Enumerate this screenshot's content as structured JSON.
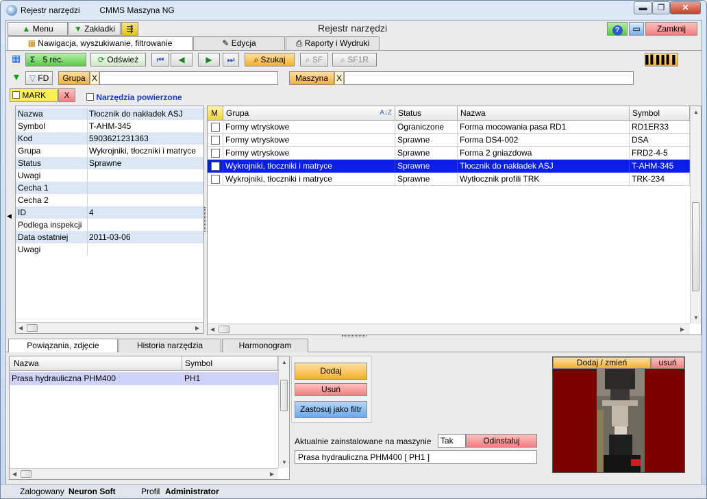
{
  "window": {
    "app_name": "Rejestr narzędzi",
    "product": "CMMS Maszyna NG",
    "minimize": "▬",
    "maximize": "❐",
    "close": "✕"
  },
  "toolbar": {
    "menu": "Menu",
    "bookmarks": "Zakładki",
    "title": "Rejestr narzędzi",
    "close": "Zamknij"
  },
  "main_tabs": [
    {
      "label": "Nawigacja, wyszukiwanie, filtrowanie"
    },
    {
      "label": "Edycja"
    },
    {
      "label": "Raporty i Wydruki"
    }
  ],
  "nav": {
    "records": "5 rec.",
    "refresh": "Odśwież",
    "search": "Szukaj",
    "sf": "SF",
    "sf1r": "SF1R"
  },
  "filters": {
    "fd": "FD",
    "group_label": "Grupa",
    "group_value": "",
    "machine_label": "Maszyna",
    "machine_value": "",
    "clear": "X",
    "mark": "MARK",
    "lent_tools": "Narzędzia powierzone"
  },
  "details": [
    {
      "key": "Nazwa",
      "value": "Tłocznik  do nakładek ASJ"
    },
    {
      "key": "Symbol",
      "value": "T-AHM-345"
    },
    {
      "key": "Kod",
      "value": "5903621231363"
    },
    {
      "key": "Grupa",
      "value": "Wykrojniki, tłoczniki i matryce"
    },
    {
      "key": "Status",
      "value": "Sprawne"
    },
    {
      "key": "Uwagi",
      "value": ""
    },
    {
      "key": "Cecha 1",
      "value": ""
    },
    {
      "key": "Cecha 2",
      "value": ""
    },
    {
      "key": "ID",
      "value": "4"
    },
    {
      "key": "Podlega inspekcji",
      "value": ""
    },
    {
      "key": "Data ostatniej",
      "value": "2011-03-06"
    },
    {
      "key": "Uwagi",
      "value": ""
    }
  ],
  "grid": {
    "headers": [
      "M",
      "Grupa",
      "Status",
      "Nazwa",
      "Symbol"
    ],
    "sort_icon": "A↓Z",
    "rows": [
      {
        "grupa": "Formy wtryskowe",
        "status": "Ograniczone",
        "nazwa": "Forma mocowania pasa RD1",
        "symbol": "RD1ER33"
      },
      {
        "grupa": "Formy wtryskowe",
        "status": "Sprawne",
        "nazwa": "Forma DS4-002",
        "symbol": "DSA"
      },
      {
        "grupa": "Formy wtryskowe",
        "status": "Sprawne",
        "nazwa": "Forma 2 gniazdowa",
        "symbol": "FRD2-4-5"
      },
      {
        "grupa": "Wykrojniki, tłoczniki i matryce",
        "status": "Sprawne",
        "nazwa": "Tłocznik  do nakładek ASJ",
        "symbol": "T-AHM-345"
      },
      {
        "grupa": "Wykrojniki, tłoczniki i matryce",
        "status": "Sprawne",
        "nazwa": "Wytłocznik profili TRK",
        "symbol": "TRK-234"
      }
    ]
  },
  "bottom_tabs": [
    {
      "label": "Powiązania, zdjęcie"
    },
    {
      "label": "Historia narzędzia"
    },
    {
      "label": "Harmonogram"
    }
  ],
  "links": {
    "headers": [
      "Nazwa",
      "Symbol"
    ],
    "rows": [
      {
        "nazwa": "Prasa hydrauliczna PHM400",
        "symbol": "PH1"
      }
    ]
  },
  "actions": {
    "add": "Dodaj",
    "remove": "Usuń",
    "apply_filter": "Zastosuj jako filtr"
  },
  "installed": {
    "label": "Aktualnie zainstalowane na maszynie",
    "value": "Tak",
    "uninstall": "Odinstaluj",
    "machine": "Prasa hydrauliczna PHM400 [ PH1 ]"
  },
  "photo": {
    "add_change": "Dodaj / zmień",
    "remove": "usuń"
  },
  "status": {
    "logged_label": "Zalogowany",
    "logged_user": "Neuron Soft",
    "profile_label": "Profil",
    "profile_value": "Administrator"
  },
  "colors": {
    "selection": "#0a1ee8",
    "photo_bg": "#7a0000",
    "accent_green": "#5dc84a",
    "accent_orange": "#f4b030"
  }
}
